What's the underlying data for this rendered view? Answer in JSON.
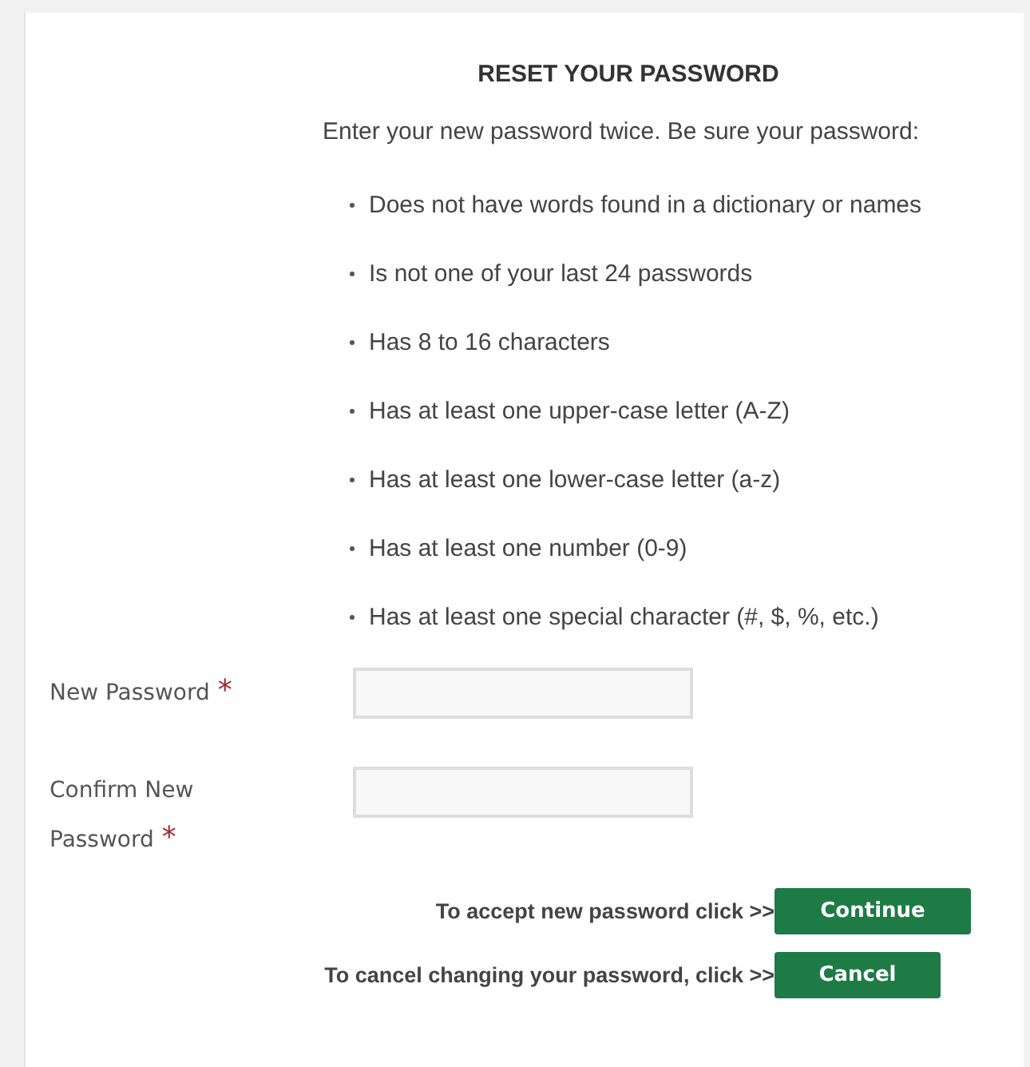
{
  "title": "RESET YOUR PASSWORD",
  "intro": "Enter your new password twice. Be sure your password:",
  "rules": [
    "Does not have words found in a dictionary or names",
    "Is not one of your last 24 passwords",
    "Has 8 to 16 characters",
    "Has at least one upper-case letter (A-Z)",
    "Has at least one lower-case letter (a-z)",
    "Has at least one number (0-9)",
    "Has at least one special character (#, $, %, etc.)"
  ],
  "fields": [
    {
      "label": "New Password",
      "required_mark": "*"
    },
    {
      "label": "Confirm New Password",
      "required_mark": "*"
    }
  ],
  "actions": [
    {
      "prompt": "To accept new password click >>",
      "button": "Continue"
    },
    {
      "prompt": "To cancel changing your password, click >>",
      "button": "Cancel"
    }
  ]
}
